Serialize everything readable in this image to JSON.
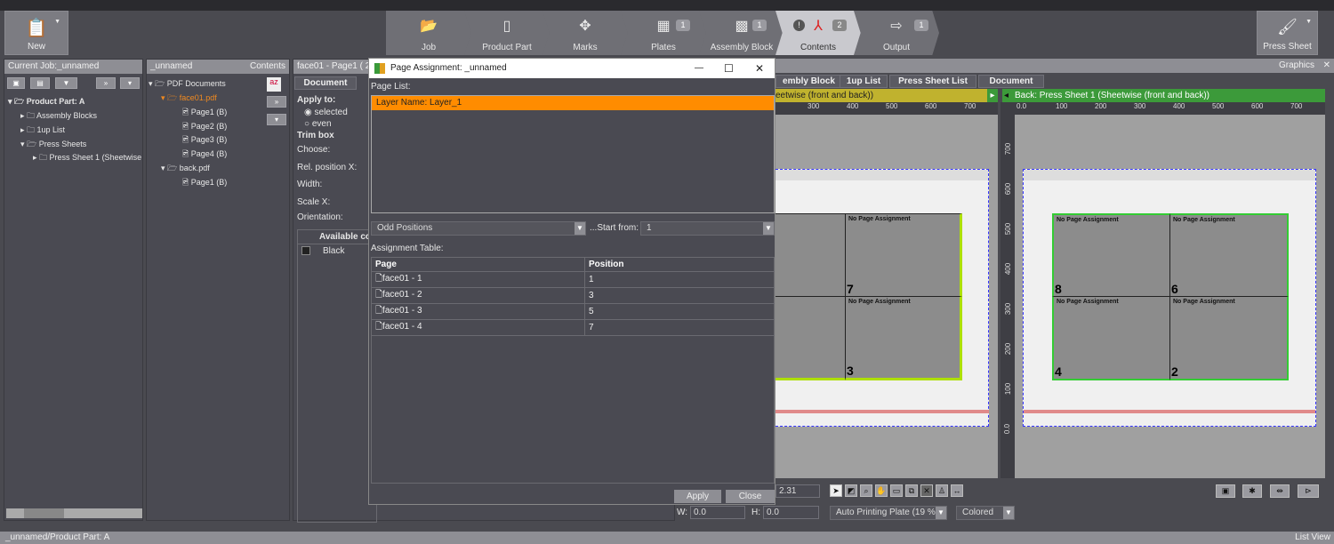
{
  "toolbar": {
    "new_label": "New",
    "press_sheet_label": "Press Sheet",
    "workflow": [
      {
        "label": "Job",
        "badge": ""
      },
      {
        "label": "Product Part",
        "badge": ""
      },
      {
        "label": "Marks",
        "badge": ""
      },
      {
        "label": "Plates",
        "badge": "1"
      },
      {
        "label": "Assembly Block",
        "badge": "1"
      },
      {
        "label": "Contents",
        "badge": "2",
        "warning": "!"
      },
      {
        "label": "Output",
        "badge": "1"
      }
    ]
  },
  "job_panel": {
    "title": "Current Job:_unnamed",
    "tree": [
      "Product Part: A",
      "Assembly Blocks",
      "1up List",
      "Press Sheets",
      "Press Sheet 1 (Sheetwise"
    ]
  },
  "contents_panel": {
    "title": "_unnamed",
    "right_title": "Contents",
    "tree": [
      "PDF Documents",
      "face01.pdf",
      "Page1 (B)",
      "Page2 (B)",
      "Page3 (B)",
      "Page4 (B)",
      "back.pdf",
      "Page1 (B)"
    ]
  },
  "doc_panel": {
    "title": "face01 - Page1 ( 2,",
    "tab": "Document",
    "apply_to": "Apply to:",
    "radio_selected": "selected",
    "radio_even": "even",
    "trim_box": "Trim box",
    "choose": "Choose:",
    "rel_pos": "Rel. position X:",
    "width": "Width:",
    "scale": "Scale X:",
    "orientation": "Orientation:",
    "colors_header": "Available col",
    "color_black": "Black"
  },
  "dialog": {
    "title": "Page Assignment: _unnamed",
    "page_list_label": "Page List:",
    "layer": "Layer Name: Layer_1",
    "positions_combo": "Odd Positions",
    "start_from_label": "...Start from:",
    "start_from_value": "1",
    "assignment_label": "Assignment Table:",
    "columns": [
      "Page",
      "Position"
    ],
    "rows": [
      {
        "page": "face01 - 1",
        "position": "1"
      },
      {
        "page": "face01 - 2",
        "position": "3"
      },
      {
        "page": "face01 - 3",
        "position": "5"
      },
      {
        "page": "face01 - 4",
        "position": "7"
      }
    ],
    "apply": "Apply",
    "close": "Close"
  },
  "graphics": {
    "header_left": "A",
    "header_right": "Graphics",
    "tabs": [
      "embly Block",
      "1up List",
      "Press Sheet List",
      "Document"
    ],
    "front_title": "eetwise (front and back))",
    "back_title": "Back:  Press Sheet 1 (Sheetwise (front and back))",
    "front_ticks": [
      "300",
      "400",
      "500",
      "600",
      "700"
    ],
    "back_ticks": [
      "0.0",
      "100",
      "200",
      "300",
      "400",
      "500",
      "600",
      "700"
    ],
    "v_ticks": [
      "700",
      "600",
      "500",
      "400",
      "300",
      "200",
      "100",
      "0.0"
    ],
    "cell_label": "No Page Assignment",
    "front_nums": [
      "7",
      "3"
    ],
    "back_nums": [
      "8",
      "6",
      "4",
      "2"
    ],
    "zoom_value": "2.31",
    "w_label": "W:",
    "w_value": "0.0",
    "h_label": "H:",
    "h_value": "0.0",
    "plate_combo": "Auto Printing Plate (19 %)",
    "color_combo": "Colored",
    "colors": {
      "front_bar": "#c0b22e",
      "back_bar": "#3c9a3a",
      "accent": "#ff8c00"
    }
  },
  "status": {
    "path": "_unnamed/Product Part: A",
    "list_view": "List View"
  }
}
